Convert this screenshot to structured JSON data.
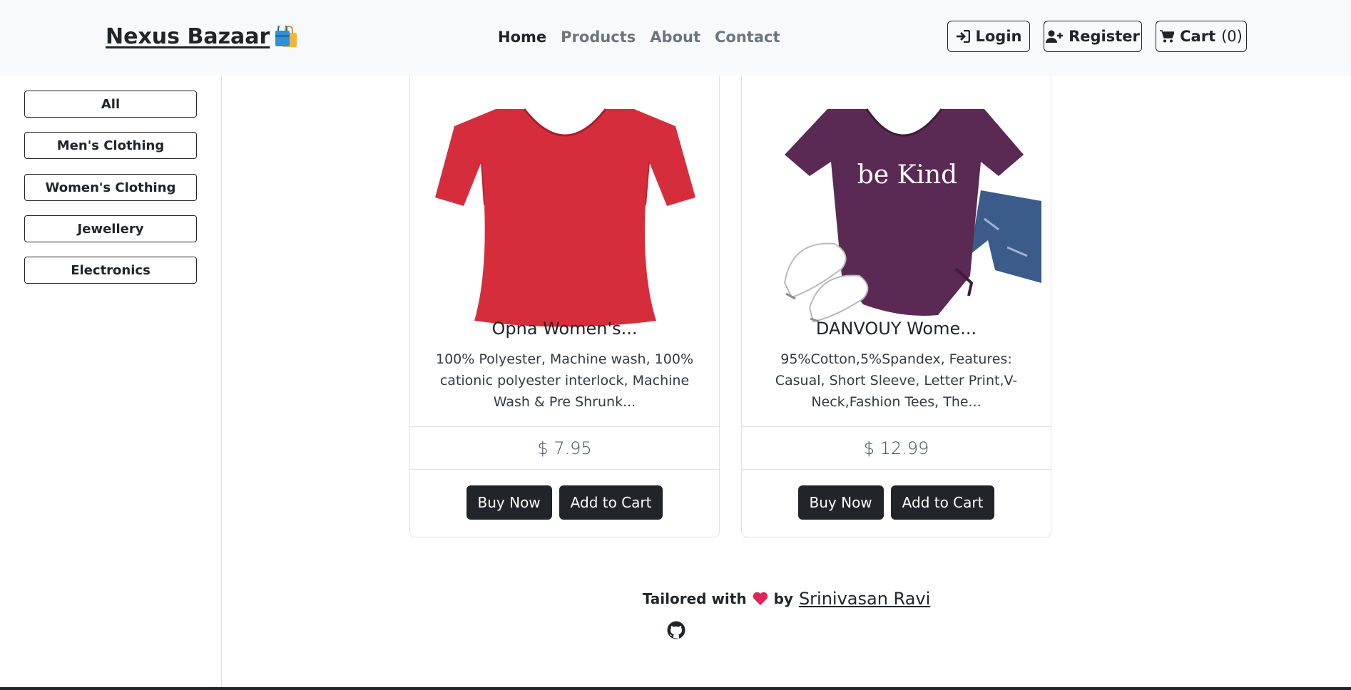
{
  "navbar": {
    "brand": "Nexus Bazaar",
    "brand_icon": "shopping-bags-icon",
    "links": [
      {
        "label": "Home",
        "active": true
      },
      {
        "label": "Products",
        "active": false
      },
      {
        "label": "About",
        "active": false
      },
      {
        "label": "Contact",
        "active": false
      }
    ],
    "login_label": "Login",
    "register_label": "Register",
    "cart_label": "Cart",
    "cart_count": "(0)"
  },
  "sidebar": {
    "categories": [
      "All",
      "Men's Clothing",
      "Women's Clothing",
      "Jewellery",
      "Electronics"
    ]
  },
  "products": [
    {
      "title": "Opna Women's...",
      "description": "100% Polyester, Machine wash, 100% cationic polyester interlock, Machine Wash & Pre Shrunk...",
      "price": "$ 7.95",
      "buy_label": "Buy Now",
      "cart_label": "Add to Cart",
      "image": "red-v-neck-tshirt"
    },
    {
      "title": "DANVOUY Wome...",
      "description": "95%Cotton,5%Spandex, Features: Casual, Short Sleeve, Letter Print,V-Neck,Fashion Tees, The...",
      "price": "$ 12.99",
      "buy_label": "Buy Now",
      "cart_label": "Add to Cart",
      "image": "purple-be-kind-tshirt",
      "image_text": "be Kind"
    }
  ],
  "footer": {
    "prefix": "Tailored with",
    "by": "by",
    "author": "Srinivasan Ravi",
    "github_icon": "github-icon"
  },
  "colors": {
    "navbar_bg": "#f8f9fa",
    "dark": "#212529",
    "muted_link": "#6c757d",
    "heart": "#e0245e",
    "red_shirt": "#d62d3c",
    "purple_shirt": "#5a2a55"
  }
}
